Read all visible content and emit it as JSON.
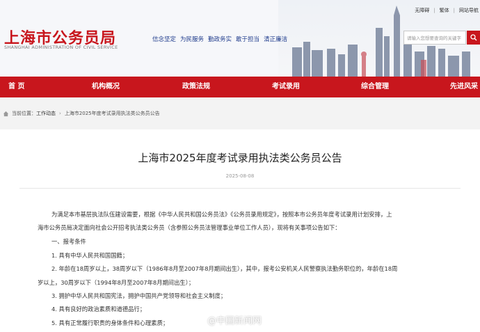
{
  "header": {
    "title": "上海市公务员局",
    "subtitle": "SHANGHAI ADMINISTRATION OF CIVIL SERVICE",
    "slogans": [
      "信念坚定",
      "为民服务",
      "勤政务实",
      "敢于担当",
      "清正廉洁"
    ],
    "toplinks": [
      "无障碍",
      "繁体",
      "网站导航"
    ],
    "search_placeholder": "请输入您想要查询的关键字"
  },
  "nav": {
    "items": [
      "首 页",
      "机构概况",
      "政策法规",
      "考试录用",
      "综合管理",
      "先进风采"
    ]
  },
  "breadcrumb": {
    "prefix": "当前位置：",
    "section": "工作动态",
    "current": "上海市2025年度考试录用执法类公务员公告"
  },
  "article": {
    "title": "上海市2025年度考试录用执法类公务员公告",
    "date": "2025-08-08",
    "lines": [
      "为满足本市基层执法队伍建设需要，根据《中华人民共和国公务员法》《公务员录用规定》，按照本市公务员年度考试录用计划安排，上",
      "海市公务员局决定面向社会公开招考执法类公务员（含参照公务员法管理事业单位工作人员），现将有关事项公告如下：",
      "一、报考条件",
      "1. 具有中华人民共和国国籍；",
      "2. 年龄在18周岁以上，38周岁以下（1986年8月至2007年8月期间出生），其中，报考公安机关人民警察执法勤务职位的，年龄在18周",
      "岁以上，30周岁以下（1994年8月至2007年8月期间出生）；",
      "3. 拥护中华人民共和国宪法，拥护中国共产党领导和社会主义制度；",
      "4. 具有良好的政治素质和道德品行；",
      "5. 具有正常履行职责的身体条件和心理素质；"
    ]
  },
  "watermark": "@中国新闻网",
  "colors": {
    "brand_red": "#c8161d",
    "slogan_blue": "#1f3b8c"
  }
}
